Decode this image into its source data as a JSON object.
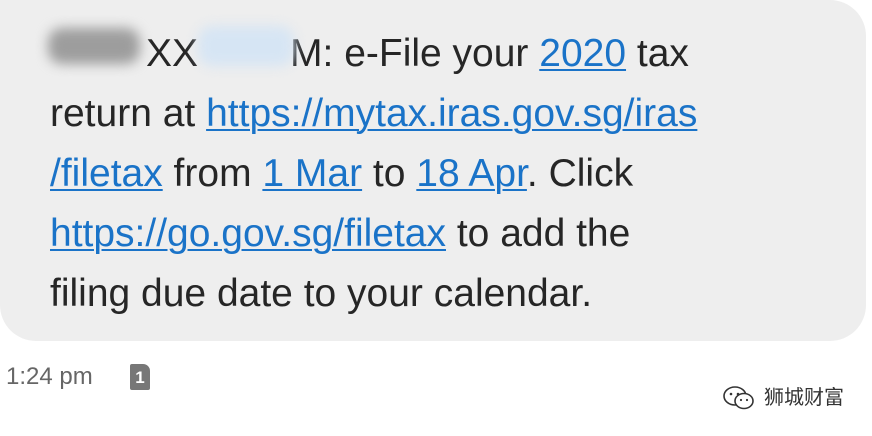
{
  "message": {
    "sender_visible": "XX",
    "sender_visible_2": "M",
    "line1_mid": ": e-File your ",
    "year": "2020",
    "line1_end": " tax",
    "line2_start": "return at ",
    "url1_part1": "https://mytax.iras.gov.sg/iras",
    "url1_part2": "/filetax",
    "from": " from ",
    "date_start": "1 Mar",
    "to": " to ",
    "date_end": "18 Apr",
    "click": ". Click",
    "url2": "https://go.gov.sg/filetax",
    "line4_end": " to add the",
    "line5": "filing due date to your calendar."
  },
  "timestamp": "1:24 pm",
  "sim_badge": "1",
  "watermark": {
    "text": "狮城财富",
    "icon": "wechat-icon"
  },
  "colors": {
    "bubble": "#eeeeee",
    "link": "#1a73c8",
    "text": "#262626"
  }
}
